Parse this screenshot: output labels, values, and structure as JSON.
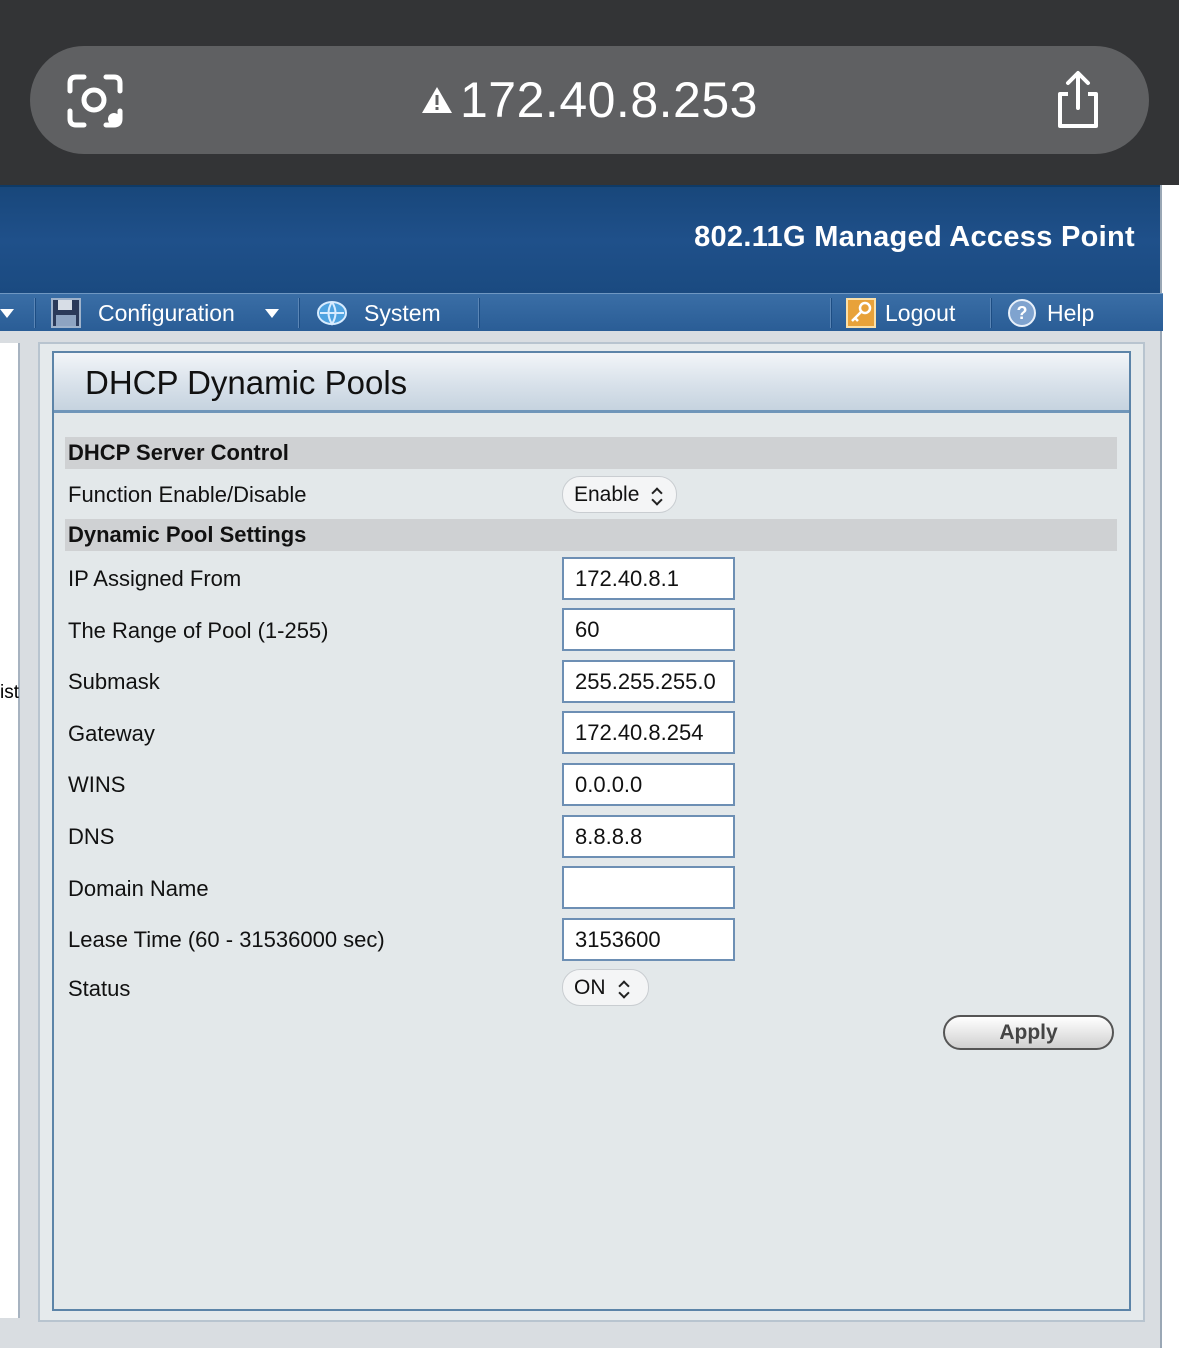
{
  "browser": {
    "url": "172.40.8.253",
    "icons": {
      "lens": "camera-lens-icon",
      "warning": "warning-icon",
      "share": "share-icon"
    }
  },
  "header": {
    "title": "802.11G Managed Access Point"
  },
  "menu": {
    "configuration": "Configuration",
    "system": "System",
    "logout": "Logout",
    "help": "Help"
  },
  "left_panel": {
    "truncated_text": "ist"
  },
  "panel": {
    "title": "DHCP Dynamic Pools",
    "server_control": {
      "heading": "DHCP Server Control",
      "function_label": "Function Enable/Disable",
      "function_value": "Enable"
    },
    "pool_settings": {
      "heading": "Dynamic Pool Settings",
      "fields": [
        {
          "label": "IP Assigned From",
          "value": "172.40.8.1"
        },
        {
          "label": "The Range of Pool (1-255)",
          "value": "60"
        },
        {
          "label": "Submask",
          "value": "255.255.255.0"
        },
        {
          "label": "Gateway",
          "value": "172.40.8.254"
        },
        {
          "label": "WINS",
          "value": "0.0.0.0"
        },
        {
          "label": "DNS",
          "value": "8.8.8.8"
        },
        {
          "label": "Domain Name",
          "value": ""
        },
        {
          "label": "Lease Time (60 - 31536000 sec)",
          "value": "3153600"
        }
      ],
      "status_label": "Status",
      "status_value": "ON"
    },
    "apply_label": "Apply"
  },
  "colors": {
    "header_blue": "#1f508a",
    "menu_blue": "#2a5d96",
    "panel_border": "#5c84a8"
  }
}
